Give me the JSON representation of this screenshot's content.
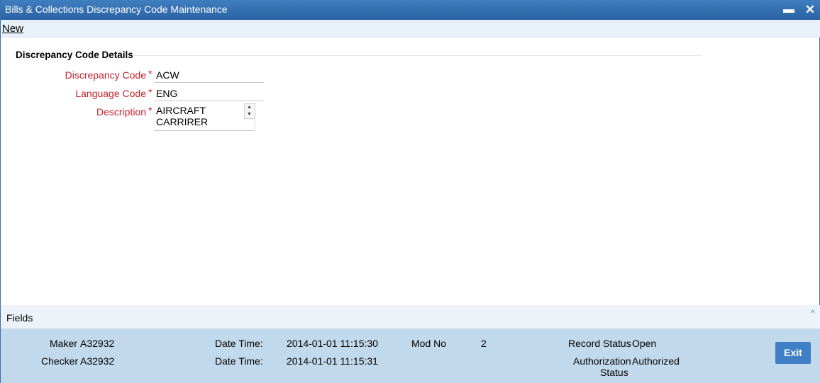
{
  "window": {
    "title": "Bills & Collections Discrepancy Code Maintenance",
    "minimize_glyph": "▬",
    "close_glyph": "✕"
  },
  "toolbar": {
    "new_label": "New"
  },
  "section": {
    "title": "Discrepancy Code Details"
  },
  "form": {
    "required_mark": "*",
    "discrepancy_code": {
      "label": "Discrepancy Code",
      "value": "ACW"
    },
    "language_code": {
      "label": "Language Code",
      "value": "ENG"
    },
    "description": {
      "label": "Description",
      "line1": "AIRCRAFT",
      "line2": "CARRIRER"
    }
  },
  "fields_bar": {
    "label": "Fields",
    "caret_glyph": "^"
  },
  "audit": {
    "maker_label": "Maker",
    "maker_value": "A32932",
    "checker_label": "Checker",
    "checker_value": "A32932",
    "date_time_label_1": "Date Time:",
    "date_time_value_1": "2014-01-01 11:15:30",
    "date_time_label_2": "Date Time:",
    "date_time_value_2": "2014-01-01 11:15:31",
    "mod_no_label": "Mod No",
    "mod_no_value": "2",
    "record_status_label": "Record Status",
    "record_status_value": "Open",
    "auth_status_label_1": "Authorization",
    "auth_status_label_2": "Status",
    "auth_status_value": "Authorized"
  },
  "buttons": {
    "exit_label": "Exit"
  },
  "colors": {
    "titlebar": "#2a63a3",
    "required": "#c4242b",
    "audit_bg": "#c2d9ec",
    "exit_bg": "#3f7fc6"
  }
}
